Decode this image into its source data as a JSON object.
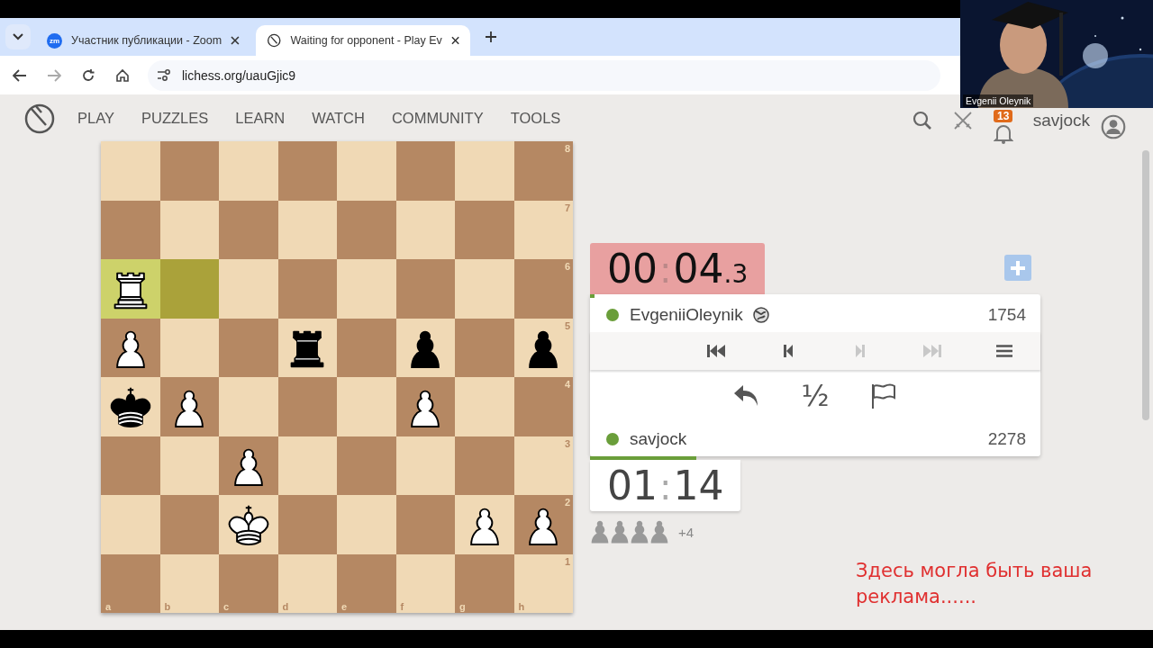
{
  "zoom_overlay": {
    "participant_name": "Evgenii Oleynik"
  },
  "browser": {
    "tabs": [
      {
        "title": "Участник публикации - Zoom",
        "favicon": "zm",
        "selected": false
      },
      {
        "title": "Waiting for opponent - Play Ev",
        "selected": true
      }
    ],
    "url": "lichess.org/uauGjic9"
  },
  "site": {
    "nav": [
      "PLAY",
      "PUZZLES",
      "LEARN",
      "WATCH",
      "COMMUNITY",
      "TOOLS"
    ],
    "notification_count": "13",
    "username": "savjock"
  },
  "board": {
    "files": [
      "a",
      "b",
      "c",
      "d",
      "e",
      "f",
      "g",
      "h"
    ],
    "ranks": [
      "8",
      "7",
      "6",
      "5",
      "4",
      "3",
      "2",
      "1"
    ],
    "rows": [
      [
        {
          "kind": "empty",
          "highlight": false
        },
        {
          "kind": "empty",
          "highlight": false
        },
        {
          "kind": "empty",
          "highlight": false
        },
        {
          "kind": "empty",
          "highlight": false
        },
        {
          "kind": "empty",
          "highlight": false
        },
        {
          "kind": "empty",
          "highlight": false
        },
        {
          "kind": "empty",
          "highlight": false
        },
        {
          "kind": "empty",
          "highlight": false
        }
      ],
      [
        {
          "kind": "empty",
          "highlight": false
        },
        {
          "kind": "empty",
          "highlight": false
        },
        {
          "kind": "empty",
          "highlight": false
        },
        {
          "kind": "empty",
          "highlight": false
        },
        {
          "kind": "empty",
          "highlight": false
        },
        {
          "kind": "empty",
          "highlight": false
        },
        {
          "kind": "empty",
          "highlight": false
        },
        {
          "kind": "empty",
          "highlight": false
        }
      ],
      [
        {
          "kind": "rook",
          "white": true,
          "highlight": true
        },
        {
          "kind": "empty",
          "highlight": true
        },
        {
          "kind": "empty",
          "highlight": false
        },
        {
          "kind": "empty",
          "highlight": false
        },
        {
          "kind": "empty",
          "highlight": false
        },
        {
          "kind": "empty",
          "highlight": false
        },
        {
          "kind": "empty",
          "highlight": false
        },
        {
          "kind": "empty",
          "highlight": false
        }
      ],
      [
        {
          "kind": "pawn",
          "white": true,
          "highlight": false
        },
        {
          "kind": "empty",
          "highlight": false
        },
        {
          "kind": "empty",
          "highlight": false
        },
        {
          "kind": "rook",
          "white": false,
          "highlight": false
        },
        {
          "kind": "empty",
          "highlight": false
        },
        {
          "kind": "pawn",
          "white": false,
          "highlight": false
        },
        {
          "kind": "empty",
          "highlight": false
        },
        {
          "kind": "pawn",
          "white": false,
          "highlight": false
        }
      ],
      [
        {
          "kind": "king",
          "white": false,
          "highlight": false
        },
        {
          "kind": "pawn",
          "white": true,
          "highlight": false
        },
        {
          "kind": "empty",
          "highlight": false
        },
        {
          "kind": "empty",
          "highlight": false
        },
        {
          "kind": "empty",
          "highlight": false
        },
        {
          "kind": "pawn",
          "white": true,
          "highlight": false
        },
        {
          "kind": "empty",
          "highlight": false
        },
        {
          "kind": "empty",
          "highlight": false
        }
      ],
      [
        {
          "kind": "empty",
          "highlight": false
        },
        {
          "kind": "empty",
          "highlight": false
        },
        {
          "kind": "pawn",
          "white": true,
          "highlight": false
        },
        {
          "kind": "empty",
          "highlight": false
        },
        {
          "kind": "empty",
          "highlight": false
        },
        {
          "kind": "empty",
          "highlight": false
        },
        {
          "kind": "empty",
          "highlight": false
        },
        {
          "kind": "empty",
          "highlight": false
        }
      ],
      [
        {
          "kind": "empty",
          "highlight": false
        },
        {
          "kind": "empty",
          "highlight": false
        },
        {
          "kind": "king",
          "white": true,
          "highlight": false
        },
        {
          "kind": "empty",
          "highlight": false
        },
        {
          "kind": "empty",
          "highlight": false
        },
        {
          "kind": "empty",
          "highlight": false
        },
        {
          "kind": "pawn",
          "white": true,
          "highlight": false
        },
        {
          "kind": "pawn",
          "white": true,
          "highlight": false
        }
      ],
      [
        {
          "kind": "empty",
          "highlight": false
        },
        {
          "kind": "empty",
          "highlight": false
        },
        {
          "kind": "empty",
          "highlight": false
        },
        {
          "kind": "empty",
          "highlight": false
        },
        {
          "kind": "empty",
          "highlight": false
        },
        {
          "kind": "empty",
          "highlight": false
        },
        {
          "kind": "empty",
          "highlight": false
        },
        {
          "kind": "empty",
          "highlight": false
        }
      ]
    ]
  },
  "game": {
    "top_clock": {
      "minutes": "00",
      "separator": ":",
      "seconds": "04",
      "tenths": ".3",
      "low_time": true
    },
    "opponent": {
      "name": "EvgeniiOleynik",
      "rating": "1754",
      "online": true
    },
    "move_controls": [
      {
        "kind": "first",
        "disabled": false
      },
      {
        "kind": "prev",
        "disabled": false
      },
      {
        "kind": "next",
        "disabled": true
      },
      {
        "kind": "last",
        "disabled": true
      },
      {
        "kind": "menu",
        "disabled": false
      }
    ],
    "actions": [
      {
        "kind": "takeback"
      },
      {
        "kind": "draw",
        "label": "½"
      },
      {
        "kind": "resign"
      }
    ],
    "player": {
      "name": "savjock",
      "rating": "2278",
      "online": true
    },
    "bottom_clock": {
      "minutes": "01",
      "separator": ":",
      "seconds": "14",
      "low_time": false
    },
    "captured": [
      {
        "kind": "pawn"
      },
      {
        "kind": "pawn"
      },
      {
        "kind": "pawn"
      },
      {
        "kind": "pawn"
      }
    ],
    "material_diff": "+4"
  },
  "ad_text": "Здесь могла быть ваша реклама......"
}
